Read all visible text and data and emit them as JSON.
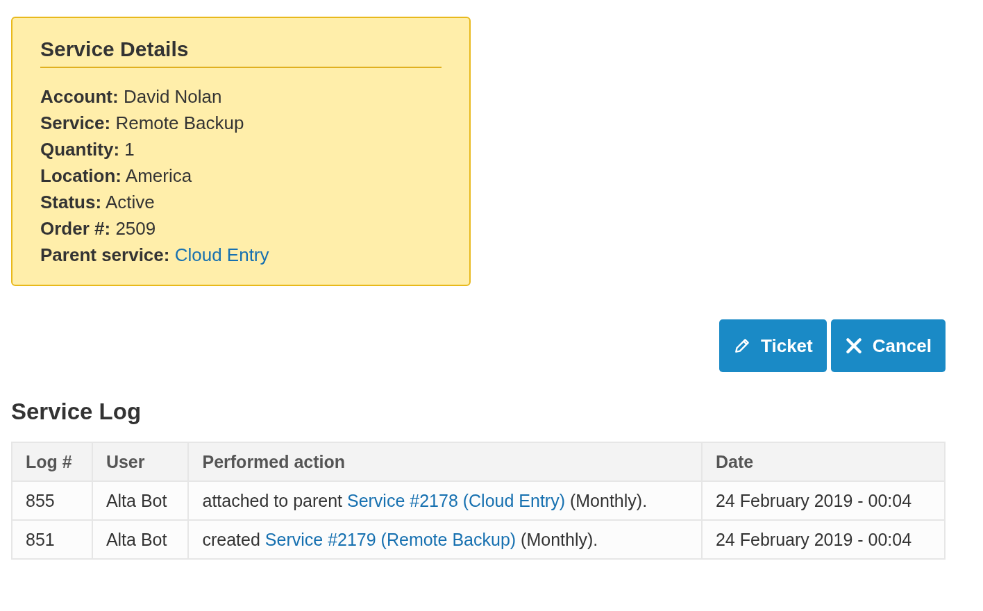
{
  "details": {
    "title": "Service Details",
    "rows": [
      {
        "kind": "text",
        "text": "**Account:** David Nolan"
      },
      {
        "kind": "text",
        "text": "**Service:** Remote Backup"
      },
      {
        "kind": "text",
        "text": "**Quantity:** 1"
      },
      {
        "kind": "text",
        "text": "**Location:** America"
      },
      {
        "kind": "text",
        "text": "**Status:** Active"
      },
      {
        "kind": "text",
        "text": "**Order #:** 2509"
      },
      {
        "kind": "link",
        "text": "**Parent service:** ",
        "link": "Cloud Entry"
      }
    ]
  },
  "buttons": [
    {
      "kind": "edit",
      "label": "Ticket"
    },
    {
      "kind": "cancel",
      "label": "Cancel"
    }
  ],
  "log": {
    "title": "Service Log",
    "columns": [
      "Log #",
      "User",
      "Performed action",
      "Date"
    ],
    "rows": [
      {
        "id": "855",
        "user": "Alta Bot",
        "before": "attached to parent ",
        "link": "Service #2178 (Cloud Entry)",
        "after": " (Monthly).",
        "date": "24 February 2019 - 00:04"
      },
      {
        "id": "851",
        "user": "Alta Bot",
        "before": "created ",
        "link": "Service #2179 (Remote Backup)",
        "after": " (Monthly).",
        "date": "24 February 2019 - 00:04"
      }
    ]
  }
}
